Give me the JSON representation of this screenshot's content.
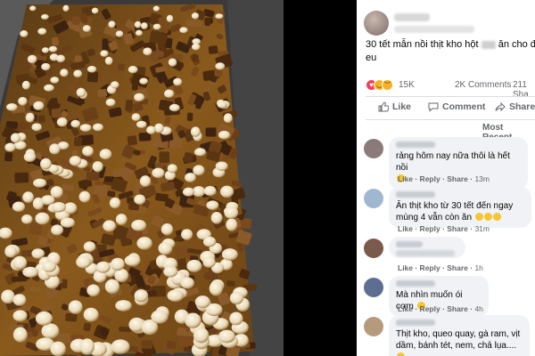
{
  "post": {
    "text_line1_start": "30 tết mẫn nồi thịt kho hột",
    "text_line1_end": "ăn cho đã cái",
    "text_line2": "eu",
    "reactions_count": "15K",
    "comments_count": "2K Comments",
    "shares_count": "211 Sha",
    "like_label": "Like",
    "comment_label": "Comment",
    "share_label": "Share",
    "sort_label": "Most Recent"
  },
  "comments": [
    {
      "text": "rảng hôm nay nữa thôi là hết nồi",
      "links": "Like · Reply · Share · ",
      "time": "13m",
      "avatar_color": "#8a7a78"
    },
    {
      "text": "Ăn thịt kho từ 30 tết đến ngay mùng 4 vẫn còn ăn",
      "links": "Like · Reply · Share · ",
      "time": "31m",
      "avatar_color": "#9fb8cf"
    },
    {
      "text": "",
      "links": "Like · Reply · Share · ",
      "time": "1h",
      "avatar_color": "#7a5a4a"
    },
    {
      "text": "Mà nhìn muốn ói cơm",
      "links": "Like · Reply · Share · ",
      "time": "4h",
      "avatar_color": "#5d6f90"
    },
    {
      "text": "Thịt kho, queo quay, gà ram, vịt dầm, bánh tét, nem, chả lụa....",
      "links": "",
      "time": "",
      "avatar_color": "#b59b7c"
    }
  ],
  "colors": {
    "panel_bg": "#ffffff",
    "text_secondary": "#65676b",
    "bubble_bg": "#f0f2f5",
    "love": "#f33e58",
    "haha": "#f7b125"
  },
  "icons": [
    "like-icon",
    "comment-icon",
    "share-icon",
    "love-reaction-icon",
    "haha-reaction-icon",
    "sad-reaction-icon"
  ]
}
